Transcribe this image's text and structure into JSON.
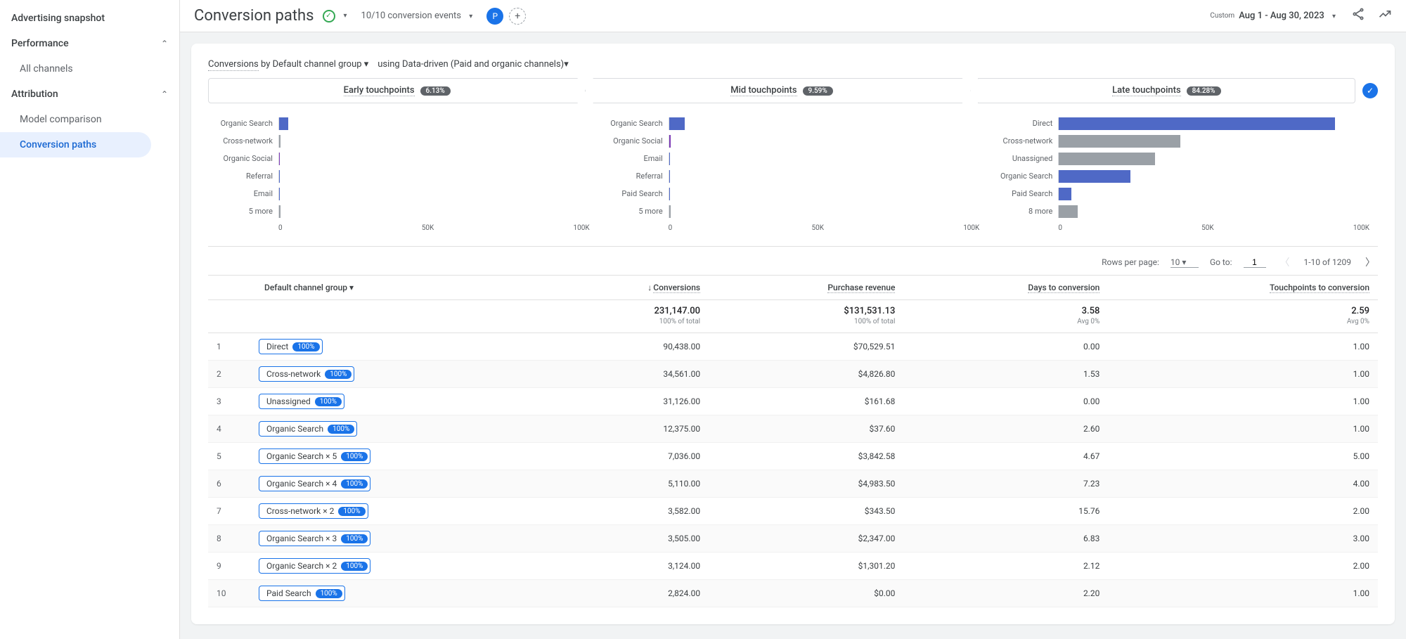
{
  "sidebar": {
    "snapshot": "Advertising snapshot",
    "sections": [
      {
        "title": "Performance",
        "items": [
          "All channels"
        ]
      },
      {
        "title": "Attribution",
        "items": [
          "Model comparison",
          "Conversion paths"
        ]
      }
    ]
  },
  "header": {
    "title": "Conversion paths",
    "events_label": "10/10 conversion events",
    "avatar": "P",
    "date_label": "Custom",
    "date_range": "Aug 1 - Aug 30, 2023"
  },
  "filter": {
    "metric": "Conversions",
    "by_label": " by ",
    "dimension": "Default channel group",
    "using_label": " using ",
    "model": "Data-driven (Paid and organic channels)"
  },
  "touchpoints": [
    {
      "label": "Early touchpoints",
      "pct": "6.13%"
    },
    {
      "label": "Mid touchpoints",
      "pct": "9.59%"
    },
    {
      "label": "Late touchpoints",
      "pct": "84.28%"
    }
  ],
  "chart_data": [
    {
      "type": "bar",
      "title": "Early touchpoints",
      "xlabel": "",
      "ylabel": "",
      "xlim": [
        0,
        100000
      ],
      "ticks": [
        "0",
        "50K",
        "100K"
      ],
      "series": [
        {
          "name": "Organic Search",
          "value": 3000,
          "color": "#4f69c6"
        },
        {
          "name": "Cross-network",
          "value": 500,
          "color": "#9aa0a6"
        },
        {
          "name": "Organic Social",
          "value": 300,
          "color": "#7b39b5"
        },
        {
          "name": "Referral",
          "value": 200,
          "color": "#4f69c6"
        },
        {
          "name": "Email",
          "value": 200,
          "color": "#4f69c6"
        },
        {
          "name": "5 more",
          "value": 500,
          "color": "#9aa0a6"
        }
      ]
    },
    {
      "type": "bar",
      "title": "Mid touchpoints",
      "xlabel": "",
      "ylabel": "",
      "xlim": [
        0,
        100000
      ],
      "ticks": [
        "0",
        "50K",
        "100K"
      ],
      "series": [
        {
          "name": "Organic Search",
          "value": 5000,
          "color": "#4f69c6"
        },
        {
          "name": "Organic Social",
          "value": 500,
          "color": "#7b39b5"
        },
        {
          "name": "Email",
          "value": 400,
          "color": "#4f69c6"
        },
        {
          "name": "Referral",
          "value": 300,
          "color": "#4f69c6"
        },
        {
          "name": "Paid Search",
          "value": 300,
          "color": "#4f69c6"
        },
        {
          "name": "5 more",
          "value": 500,
          "color": "#9aa0a6"
        }
      ]
    },
    {
      "type": "bar",
      "title": "Late touchpoints",
      "xlabel": "",
      "ylabel": "",
      "xlim": [
        0,
        100000
      ],
      "ticks": [
        "0",
        "50K",
        "100K"
      ],
      "series": [
        {
          "name": "Direct",
          "value": 89000,
          "color": "#4f69c6"
        },
        {
          "name": "Cross-network",
          "value": 39000,
          "color": "#9aa0a6"
        },
        {
          "name": "Unassigned",
          "value": 31000,
          "color": "#9aa0a6"
        },
        {
          "name": "Organic Search",
          "value": 23000,
          "color": "#4f69c6"
        },
        {
          "name": "Paid Search",
          "value": 4000,
          "color": "#4f69c6"
        },
        {
          "name": "8 more",
          "value": 6000,
          "color": "#9aa0a6"
        }
      ]
    }
  ],
  "table": {
    "rows_per_page_label": "Rows per page:",
    "rows_per_page": "10",
    "goto_label": "Go to:",
    "goto_value": "1",
    "range_label": "1-10 of 1209",
    "dim_header": "Default channel group",
    "columns": [
      "Conversions",
      "Purchase revenue",
      "Days to conversion",
      "Touchpoints to conversion"
    ],
    "totals": {
      "conversions": "231,147.00",
      "conversions_sub": "100% of total",
      "revenue": "$131,531.13",
      "revenue_sub": "100% of total",
      "days": "3.58",
      "days_sub": "Avg 0%",
      "tp": "2.59",
      "tp_sub": "Avg 0%"
    },
    "rows": [
      {
        "idx": "1",
        "path": "Direct",
        "pct": "100%",
        "conv": "90,438.00",
        "rev": "$70,529.51",
        "days": "0.00",
        "tp": "1.00"
      },
      {
        "idx": "2",
        "path": "Cross-network",
        "pct": "100%",
        "conv": "34,561.00",
        "rev": "$4,826.80",
        "days": "1.53",
        "tp": "1.00"
      },
      {
        "idx": "3",
        "path": "Unassigned",
        "pct": "100%",
        "conv": "31,126.00",
        "rev": "$161.68",
        "days": "0.00",
        "tp": "1.00"
      },
      {
        "idx": "4",
        "path": "Organic Search",
        "pct": "100%",
        "conv": "12,375.00",
        "rev": "$37.60",
        "days": "2.60",
        "tp": "1.00"
      },
      {
        "idx": "5",
        "path": "Organic Search × 5",
        "pct": "100%",
        "conv": "7,036.00",
        "rev": "$3,842.58",
        "days": "4.67",
        "tp": "5.00"
      },
      {
        "idx": "6",
        "path": "Organic Search × 4",
        "pct": "100%",
        "conv": "5,110.00",
        "rev": "$4,983.50",
        "days": "7.23",
        "tp": "4.00"
      },
      {
        "idx": "7",
        "path": "Cross-network × 2",
        "pct": "100%",
        "conv": "3,582.00",
        "rev": "$343.50",
        "days": "15.76",
        "tp": "2.00"
      },
      {
        "idx": "8",
        "path": "Organic Search × 3",
        "pct": "100%",
        "conv": "3,505.00",
        "rev": "$2,347.00",
        "days": "6.83",
        "tp": "3.00"
      },
      {
        "idx": "9",
        "path": "Organic Search × 2",
        "pct": "100%",
        "conv": "3,124.00",
        "rev": "$1,301.20",
        "days": "2.12",
        "tp": "2.00"
      },
      {
        "idx": "10",
        "path": "Paid Search",
        "pct": "100%",
        "conv": "2,824.00",
        "rev": "$0.00",
        "days": "2.20",
        "tp": "1.00"
      }
    ]
  }
}
